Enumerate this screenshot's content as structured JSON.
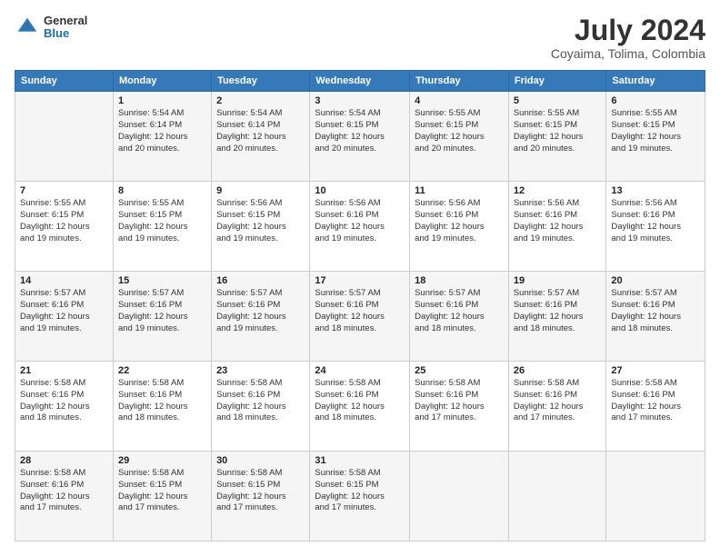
{
  "header": {
    "logo": {
      "general": "General",
      "blue": "Blue"
    },
    "month": "July 2024",
    "location": "Coyaima, Tolima, Colombia"
  },
  "weekdays": [
    "Sunday",
    "Monday",
    "Tuesday",
    "Wednesday",
    "Thursday",
    "Friday",
    "Saturday"
  ],
  "weeks": [
    [
      {
        "day": "",
        "info": ""
      },
      {
        "day": "1",
        "info": "Sunrise: 5:54 AM\nSunset: 6:14 PM\nDaylight: 12 hours\nand 20 minutes."
      },
      {
        "day": "2",
        "info": "Sunrise: 5:54 AM\nSunset: 6:14 PM\nDaylight: 12 hours\nand 20 minutes."
      },
      {
        "day": "3",
        "info": "Sunrise: 5:54 AM\nSunset: 6:15 PM\nDaylight: 12 hours\nand 20 minutes."
      },
      {
        "day": "4",
        "info": "Sunrise: 5:55 AM\nSunset: 6:15 PM\nDaylight: 12 hours\nand 20 minutes."
      },
      {
        "day": "5",
        "info": "Sunrise: 5:55 AM\nSunset: 6:15 PM\nDaylight: 12 hours\nand 20 minutes."
      },
      {
        "day": "6",
        "info": "Sunrise: 5:55 AM\nSunset: 6:15 PM\nDaylight: 12 hours\nand 19 minutes."
      }
    ],
    [
      {
        "day": "7",
        "info": "Sunrise: 5:55 AM\nSunset: 6:15 PM\nDaylight: 12 hours\nand 19 minutes."
      },
      {
        "day": "8",
        "info": "Sunrise: 5:55 AM\nSunset: 6:15 PM\nDaylight: 12 hours\nand 19 minutes."
      },
      {
        "day": "9",
        "info": "Sunrise: 5:56 AM\nSunset: 6:15 PM\nDaylight: 12 hours\nand 19 minutes."
      },
      {
        "day": "10",
        "info": "Sunrise: 5:56 AM\nSunset: 6:16 PM\nDaylight: 12 hours\nand 19 minutes."
      },
      {
        "day": "11",
        "info": "Sunrise: 5:56 AM\nSunset: 6:16 PM\nDaylight: 12 hours\nand 19 minutes."
      },
      {
        "day": "12",
        "info": "Sunrise: 5:56 AM\nSunset: 6:16 PM\nDaylight: 12 hours\nand 19 minutes."
      },
      {
        "day": "13",
        "info": "Sunrise: 5:56 AM\nSunset: 6:16 PM\nDaylight: 12 hours\nand 19 minutes."
      }
    ],
    [
      {
        "day": "14",
        "info": "Sunrise: 5:57 AM\nSunset: 6:16 PM\nDaylight: 12 hours\nand 19 minutes."
      },
      {
        "day": "15",
        "info": "Sunrise: 5:57 AM\nSunset: 6:16 PM\nDaylight: 12 hours\nand 19 minutes."
      },
      {
        "day": "16",
        "info": "Sunrise: 5:57 AM\nSunset: 6:16 PM\nDaylight: 12 hours\nand 19 minutes."
      },
      {
        "day": "17",
        "info": "Sunrise: 5:57 AM\nSunset: 6:16 PM\nDaylight: 12 hours\nand 18 minutes."
      },
      {
        "day": "18",
        "info": "Sunrise: 5:57 AM\nSunset: 6:16 PM\nDaylight: 12 hours\nand 18 minutes."
      },
      {
        "day": "19",
        "info": "Sunrise: 5:57 AM\nSunset: 6:16 PM\nDaylight: 12 hours\nand 18 minutes."
      },
      {
        "day": "20",
        "info": "Sunrise: 5:57 AM\nSunset: 6:16 PM\nDaylight: 12 hours\nand 18 minutes."
      }
    ],
    [
      {
        "day": "21",
        "info": "Sunrise: 5:58 AM\nSunset: 6:16 PM\nDaylight: 12 hours\nand 18 minutes."
      },
      {
        "day": "22",
        "info": "Sunrise: 5:58 AM\nSunset: 6:16 PM\nDaylight: 12 hours\nand 18 minutes."
      },
      {
        "day": "23",
        "info": "Sunrise: 5:58 AM\nSunset: 6:16 PM\nDaylight: 12 hours\nand 18 minutes."
      },
      {
        "day": "24",
        "info": "Sunrise: 5:58 AM\nSunset: 6:16 PM\nDaylight: 12 hours\nand 18 minutes."
      },
      {
        "day": "25",
        "info": "Sunrise: 5:58 AM\nSunset: 6:16 PM\nDaylight: 12 hours\nand 17 minutes."
      },
      {
        "day": "26",
        "info": "Sunrise: 5:58 AM\nSunset: 6:16 PM\nDaylight: 12 hours\nand 17 minutes."
      },
      {
        "day": "27",
        "info": "Sunrise: 5:58 AM\nSunset: 6:16 PM\nDaylight: 12 hours\nand 17 minutes."
      }
    ],
    [
      {
        "day": "28",
        "info": "Sunrise: 5:58 AM\nSunset: 6:16 PM\nDaylight: 12 hours\nand 17 minutes."
      },
      {
        "day": "29",
        "info": "Sunrise: 5:58 AM\nSunset: 6:15 PM\nDaylight: 12 hours\nand 17 minutes."
      },
      {
        "day": "30",
        "info": "Sunrise: 5:58 AM\nSunset: 6:15 PM\nDaylight: 12 hours\nand 17 minutes."
      },
      {
        "day": "31",
        "info": "Sunrise: 5:58 AM\nSunset: 6:15 PM\nDaylight: 12 hours\nand 17 minutes."
      },
      {
        "day": "",
        "info": ""
      },
      {
        "day": "",
        "info": ""
      },
      {
        "day": "",
        "info": ""
      }
    ]
  ]
}
